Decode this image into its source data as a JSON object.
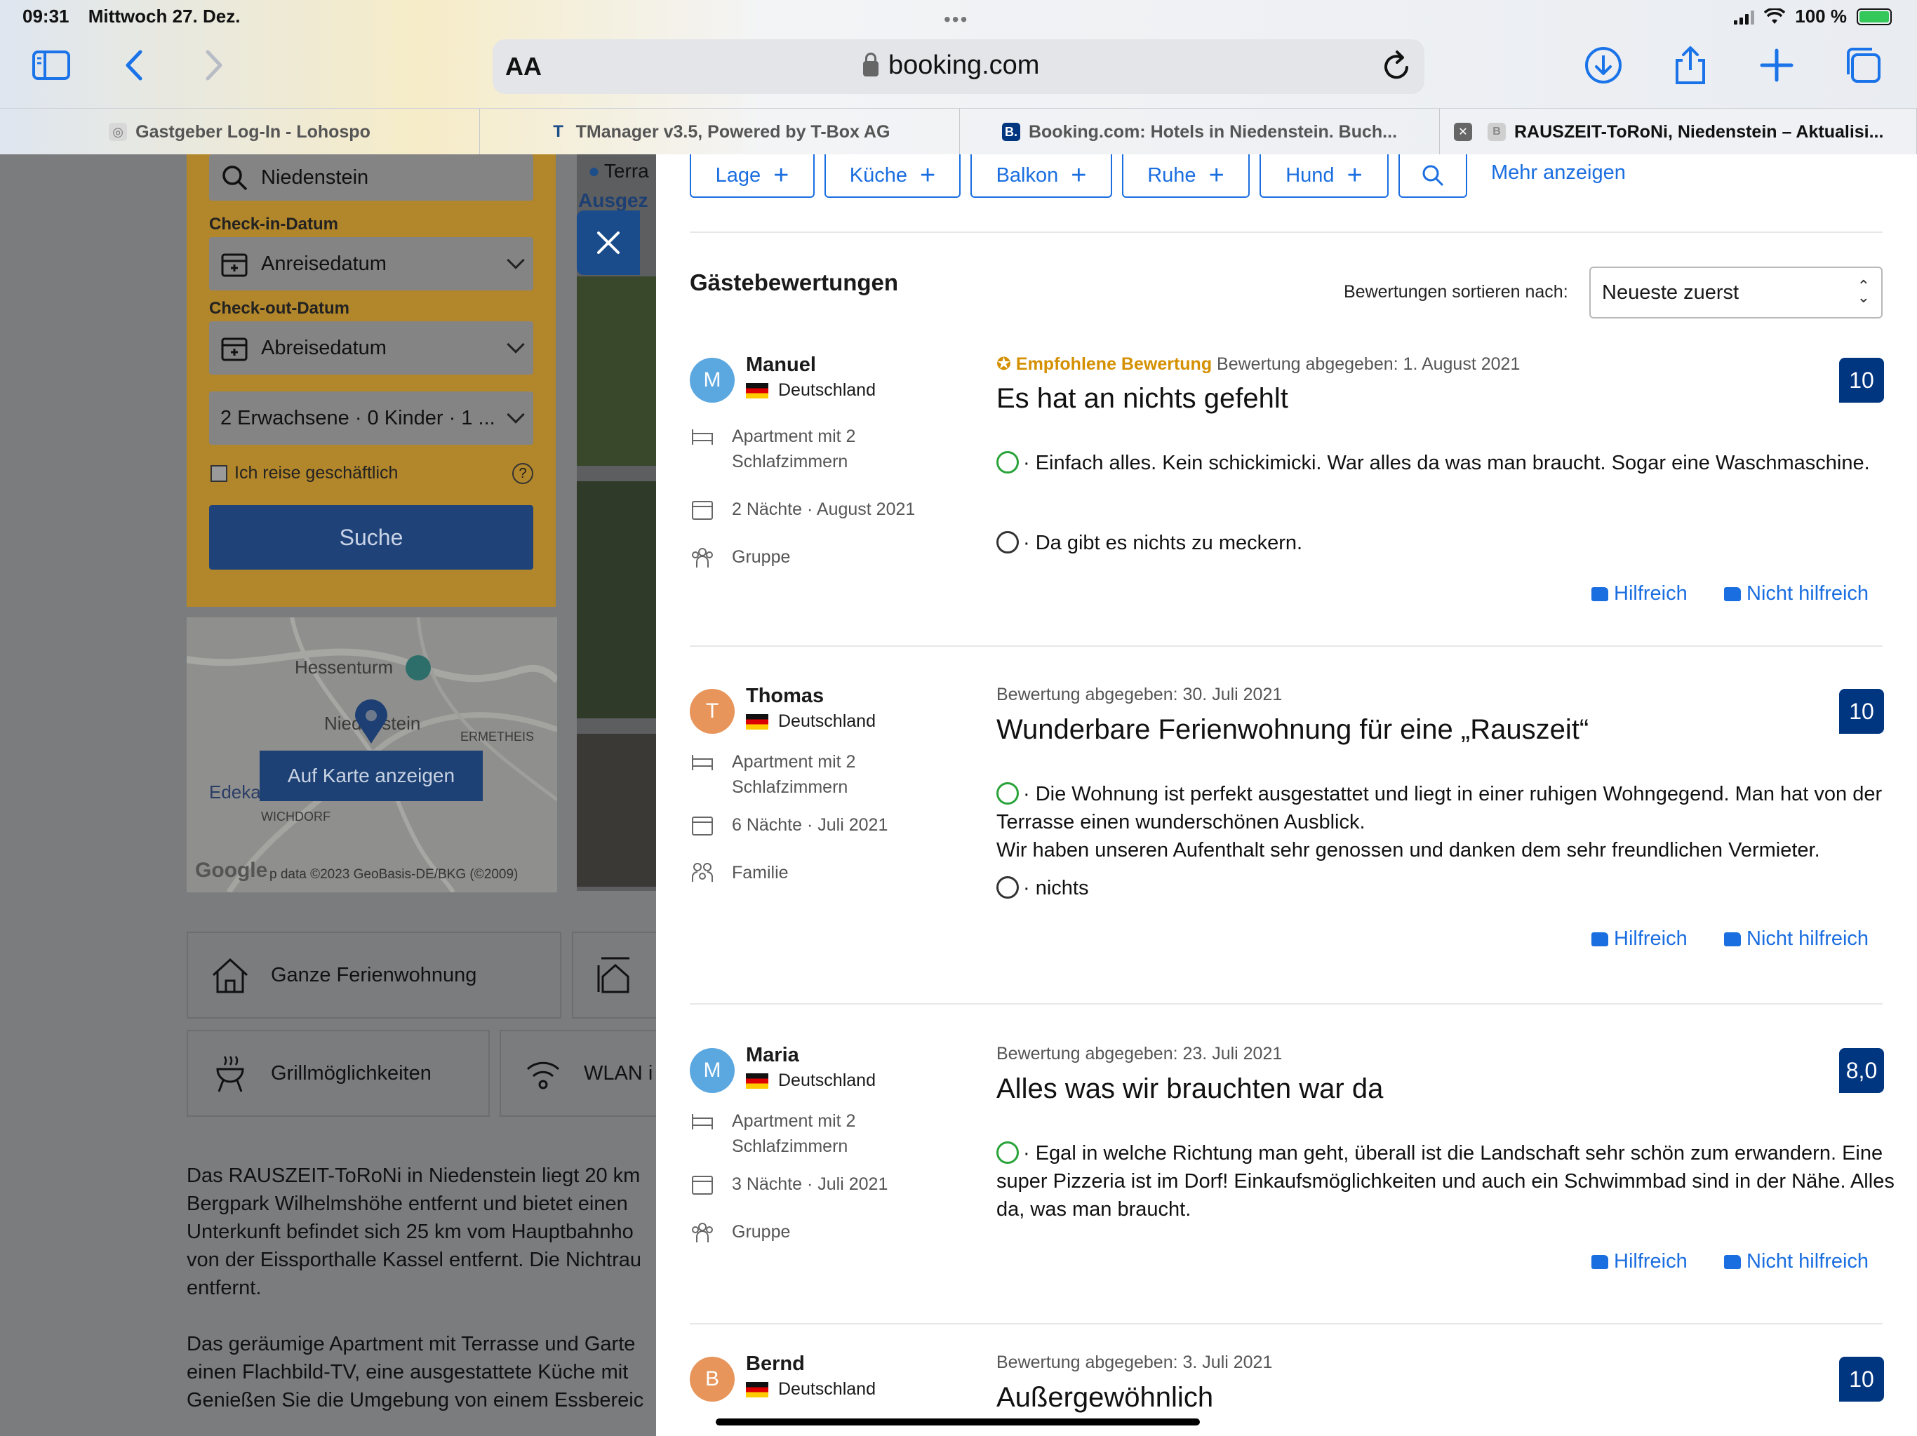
{
  "status_bar": {
    "time": "09:31",
    "date": "Mittwoch 27. Dez.",
    "battery": "100 %"
  },
  "browser": {
    "text_size_label": "AA",
    "url": "booking.com",
    "tabs": [
      {
        "label": "Gastgeber Log-In - Lohospo",
        "favicon": "lohospo-icon",
        "color": "#bbbbbb"
      },
      {
        "label": "TManager v3.5, Powered by T-Box AG",
        "favicon": "tbox-icon",
        "color": "#1d4e89"
      },
      {
        "label": "Booking.com: Hotels in Niedenstein. Buch...",
        "favicon": "booking-icon",
        "color": "#003580"
      },
      {
        "label": "RAUSZEIT-ToRoNi, Niedenstein – Aktualisi...",
        "favicon": "booking-icon",
        "color": "#cfcfcf",
        "active": true
      }
    ]
  },
  "search": {
    "destination": "Niedenstein",
    "checkin_label": "Check-in-Datum",
    "checkin_value": "Anreisedatum",
    "checkout_label": "Check-out-Datum",
    "checkout_value": "Abreisedatum",
    "guests": "2 Erwachsene · 0 Kinder · 1 ...",
    "business_label": "Ich reise geschäftlich",
    "search_button": "Suche"
  },
  "map": {
    "show_on_map": "Auf Karte anzeigen",
    "label_hessenturm": "Hessenturm",
    "label_niedenstein": "Niedenstein",
    "label_ermetheis": "ERMETHEIS",
    "label_edeka": "Edeka",
    "label_wichdorf": "WICHDORF",
    "google": "Google",
    "attribution": "p data ©2023 GeoBasis-DE/BKG (©2009)"
  },
  "property": {
    "location_partial": "Terra",
    "rating_partial": "Ausgez",
    "features": [
      "Ganze Ferienwohnung",
      "Grillmöglichkeiten",
      "WLAN i"
    ],
    "description_1": [
      "Das RAUSZEIT-ToRoNi in Niedenstein liegt 20 km",
      "Bergpark Wilhelmshöhe entfernt und bietet einen",
      "Unterkunft befindet sich 25 km vom Hauptbahnho",
      "von der Eissporthalle Kassel entfernt. Die Nichtrau",
      "entfernt."
    ],
    "description_2": [
      "Das geräumige Apartment mit Terrasse und Garte",
      "einen Flachbild-TV, eine ausgestattete Küche mit",
      "Genießen Sie die Umgebung von einem Essbereic"
    ]
  },
  "filters": {
    "chips": [
      "Lage",
      "Küche",
      "Balkon",
      "Ruhe",
      "Hund"
    ],
    "more": "Mehr anzeigen"
  },
  "reviews_header": {
    "title": "Gästebewertungen",
    "sort_label": "Bewertungen sortieren nach:",
    "sort_value": "Neueste zuerst"
  },
  "reviews": [
    {
      "initial": "M",
      "avatar_color": "#5ba7e0",
      "name": "Manuel",
      "country": "Deutschland",
      "room": [
        "Apartment mit 2",
        "Schlafzimmern"
      ],
      "stay": "2 Nächte · August 2021",
      "group": "Gruppe",
      "recommended": "Empfohlene Bewertung",
      "date": "Bewertung abgegeben: 1. August 2021",
      "title": "Es hat an nichts gefehlt",
      "positive": "· Einfach alles. Kein schickimicki. War alles da was man braucht. Sogar eine Waschmaschine.",
      "negative": "· Da gibt es nichts zu meckern.",
      "score": "10",
      "helpful": "Hilfreich",
      "not_helpful": "Nicht hilfreich"
    },
    {
      "initial": "T",
      "avatar_color": "#e7955b",
      "name": "Thomas",
      "country": "Deutschland",
      "room": [
        "Apartment mit 2",
        "Schlafzimmern"
      ],
      "stay": "6 Nächte · Juli 2021",
      "group": "Familie",
      "date": "Bewertung abgegeben: 30. Juli 2021",
      "title": "Wunderbare Ferienwohnung für eine „Rauszeit“",
      "positive": "· Die Wohnung ist perfekt ausgestattet und liegt in einer ruhigen Wohngegend. Man hat von der Terrasse einen wunderschönen Ausblick.",
      "positive_2": "Wir haben unseren Aufenthalt sehr genossen und danken dem sehr freundlichen Vermieter.",
      "negative": "· nichts",
      "score": "10",
      "helpful": "Hilfreich",
      "not_helpful": "Nicht hilfreich"
    },
    {
      "initial": "M",
      "avatar_color": "#5ba7e0",
      "name": "Maria",
      "country": "Deutschland",
      "room": [
        "Apartment mit 2",
        "Schlafzimmern"
      ],
      "stay": "3 Nächte · Juli 2021",
      "group": "Gruppe",
      "date": "Bewertung abgegeben: 23. Juli 2021",
      "title": "Alles was wir brauchten war da",
      "positive": "· Egal in welche Richtung man geht, überall ist die Landschaft sehr schön zum erwandern. Eine super Pizzeria ist im Dorf! Einkaufsmöglichkeiten und auch ein Schwimmbad sind in der Nähe. Alles da, was man braucht.",
      "score": "8,0",
      "helpful": "Hilfreich",
      "not_helpful": "Nicht hilfreich"
    },
    {
      "initial": "B",
      "avatar_color": "#e7955b",
      "name": "Bernd",
      "country": "Deutschland",
      "date": "Bewertung abgegeben: 3. Juli 2021",
      "title": "Außergewöhnlich",
      "score": "10"
    }
  ],
  "colors": {
    "accent": "#1a6ee0",
    "score_bg": "#003580",
    "recommended": "#d49000",
    "positive_smiley": "#2aa33a"
  }
}
